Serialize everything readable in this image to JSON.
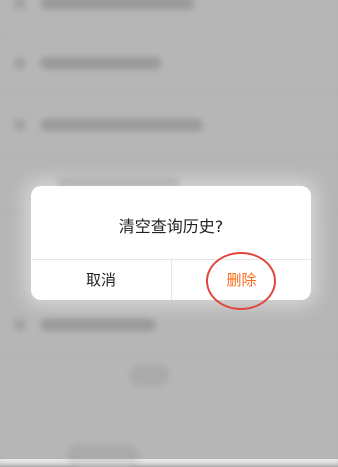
{
  "dialog": {
    "title": "清空查询历史?",
    "cancel_label": "取消",
    "delete_label": "删除"
  },
  "colors": {
    "delete_accent": "#ff6a1a",
    "annotation": "#e0463f",
    "overlay": "#5a5a5a"
  }
}
